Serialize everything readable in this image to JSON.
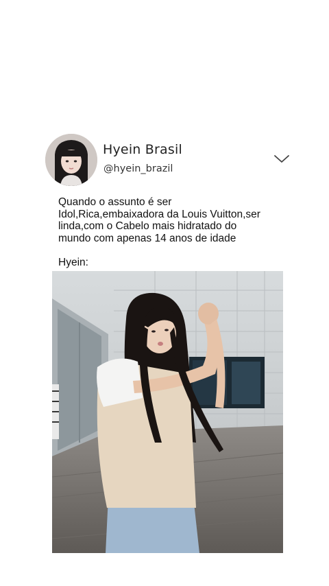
{
  "post": {
    "author": {
      "display_name": "Hyein Brasil",
      "handle": "@hyein_brazil",
      "avatar_icon": "profile-photo"
    },
    "menu_icon": "chevron-down-icon",
    "text_line_1": "Quando o assunto é ser",
    "text_line_2": "Idol,Rica,embaixadora da Louis Vuitton,ser",
    "text_line_3": "linda,com o Cabelo mais hidratado do",
    "text_line_4": "mundo com apenas 14 anos de idade",
    "text_line_5": "Hyein:",
    "media": {
      "type": "photo",
      "description_icon": "video-thumbnail"
    }
  }
}
